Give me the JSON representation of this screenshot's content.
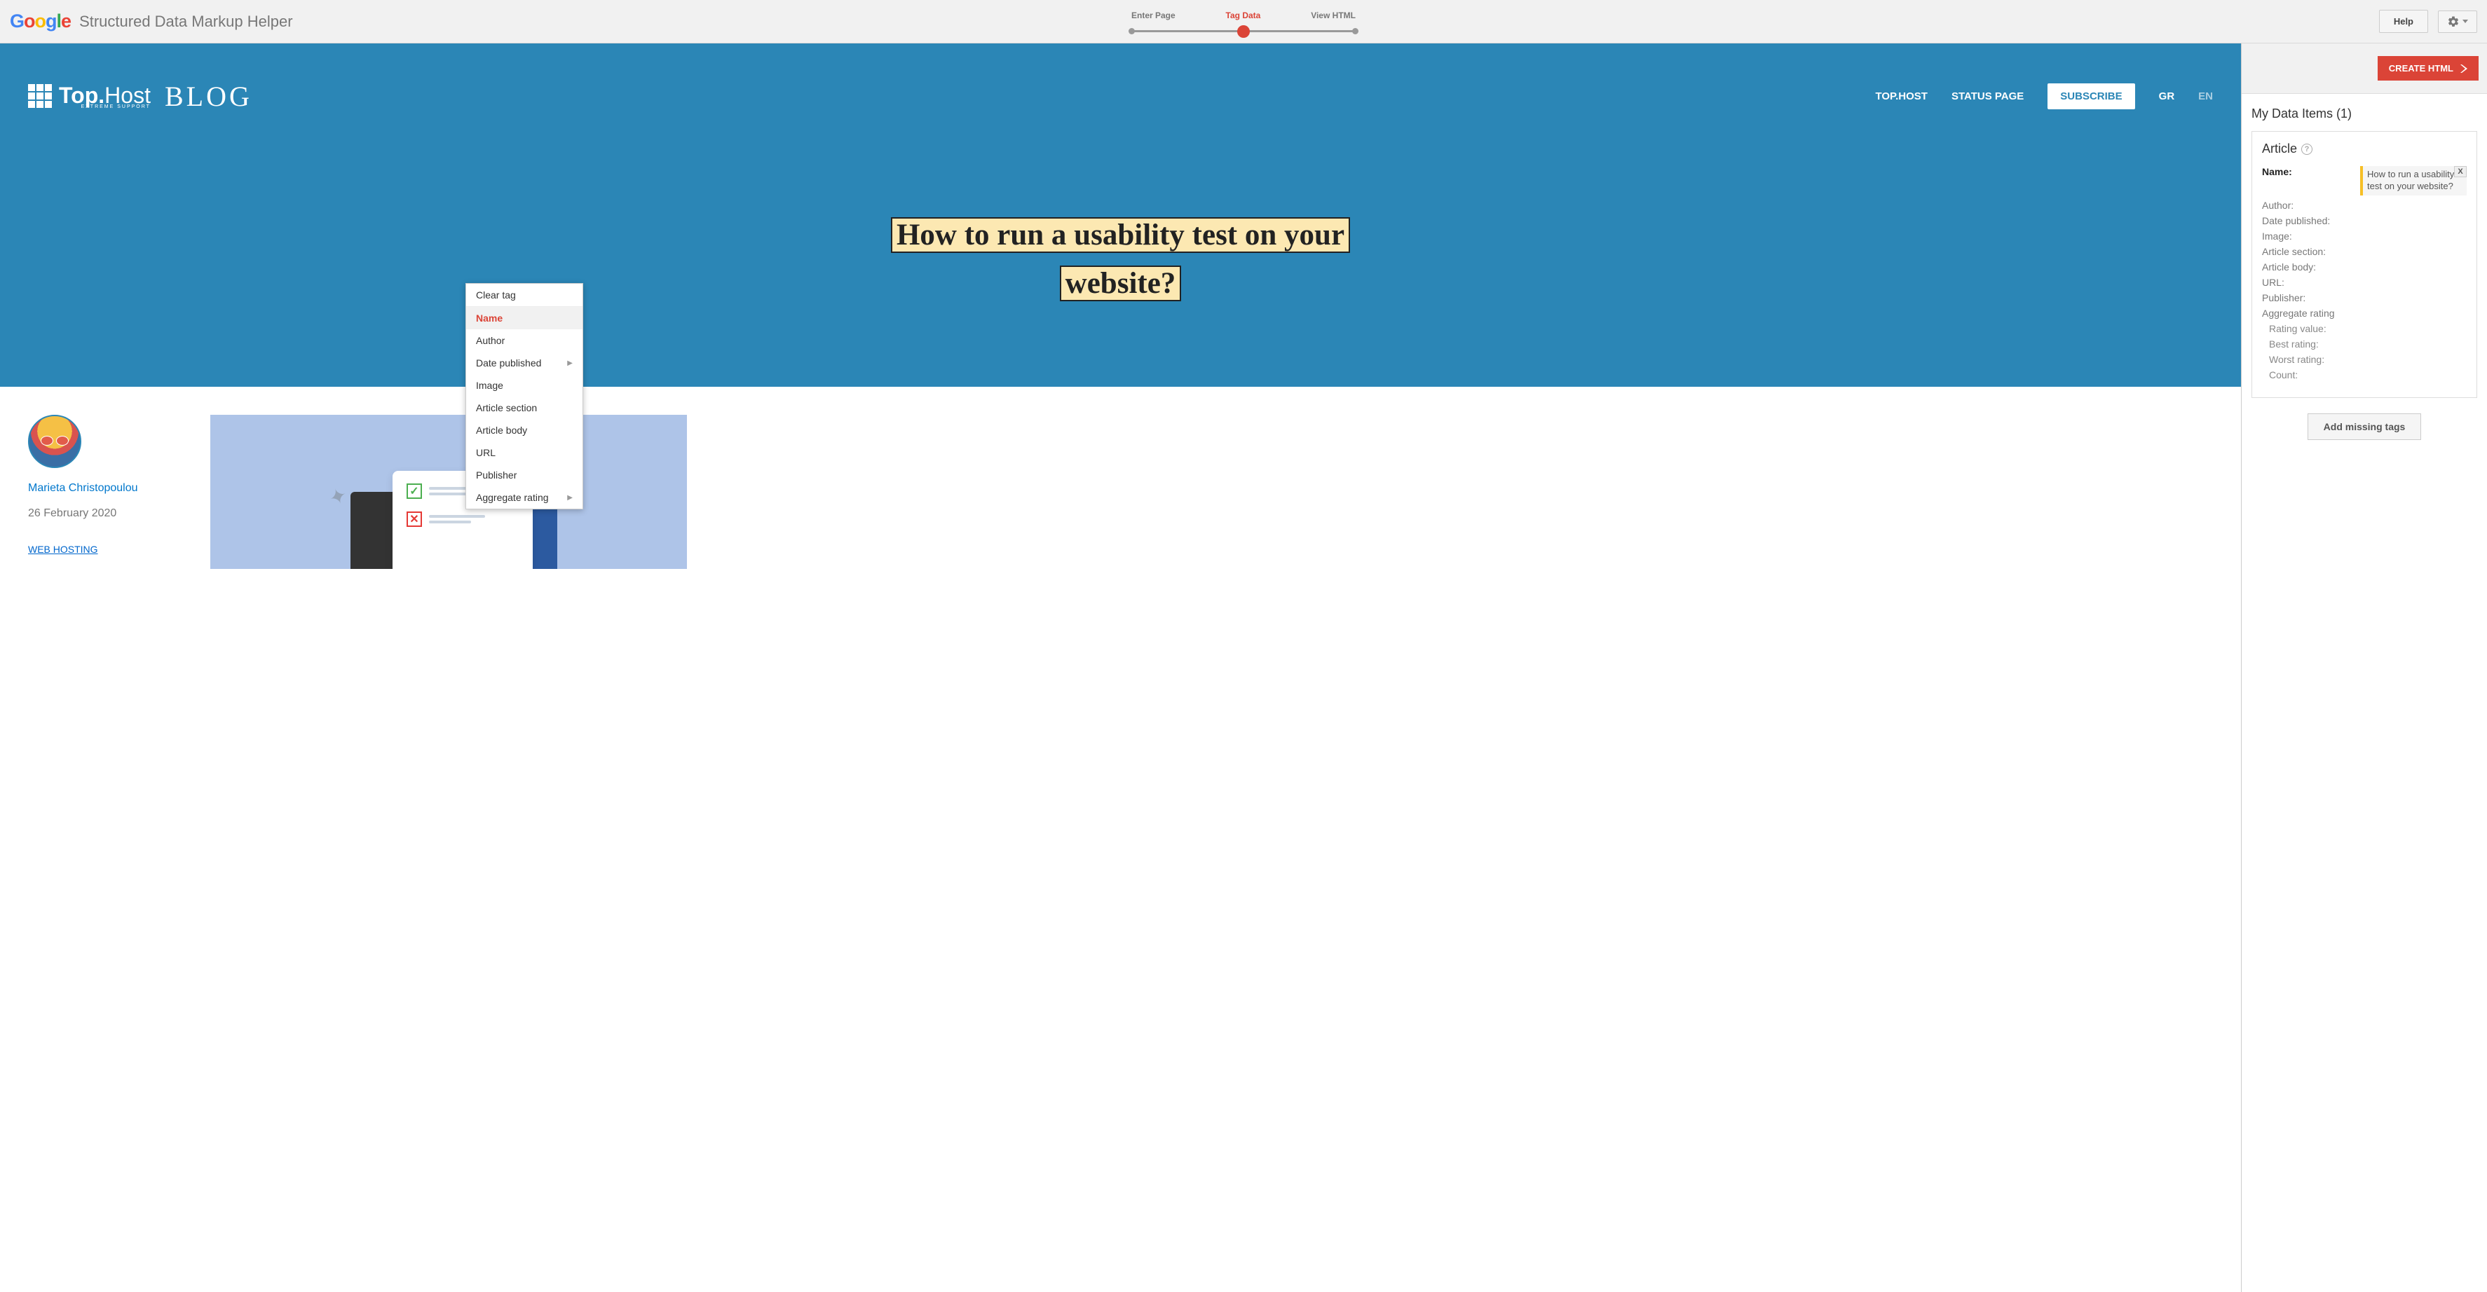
{
  "top": {
    "app_title": "Structured Data Markup Helper",
    "steps": {
      "enter": "Enter Page",
      "tag": "Tag Data",
      "view": "View HTML"
    },
    "help_label": "Help"
  },
  "preview": {
    "nav": {
      "tophost": "TOP.HOST",
      "status": "STATUS PAGE",
      "subscribe": "SUBSCRIBE",
      "gr": "GR",
      "en": "EN"
    },
    "brand": {
      "name_main": "Top.",
      "name_light": "Host",
      "tagline": "EXTREME SUPPORT",
      "blog": "BLOG"
    },
    "headline": "How to run a usability test on your website?",
    "author": "Marieta Christopoulou",
    "date": "26 February 2020",
    "category": "WEB HOSTING"
  },
  "context_menu": {
    "clear": "Clear tag",
    "items": [
      "Name",
      "Author",
      "Date published",
      "Image",
      "Article section",
      "Article body",
      "URL",
      "Publisher",
      "Aggregate rating"
    ],
    "has_submenu": [
      "Date published",
      "Aggregate rating"
    ],
    "selected": "Name"
  },
  "side": {
    "create_html": "CREATE HTML",
    "panel_title": "My Data Items (1)",
    "card_heading": "Article",
    "fields": {
      "name_label": "Name:",
      "name_value": "How to run a usability test on your website?",
      "author": "Author:",
      "date_published": "Date published:",
      "image": "Image:",
      "article_section": "Article section:",
      "article_body": "Article body:",
      "url": "URL:",
      "publisher": "Publisher:",
      "aggregate_rating": "Aggregate rating",
      "rating_value": "Rating value:",
      "best_rating": "Best rating:",
      "worst_rating": "Worst rating:",
      "count": "Count:"
    },
    "add_missing": "Add missing tags",
    "close_x": "X"
  }
}
